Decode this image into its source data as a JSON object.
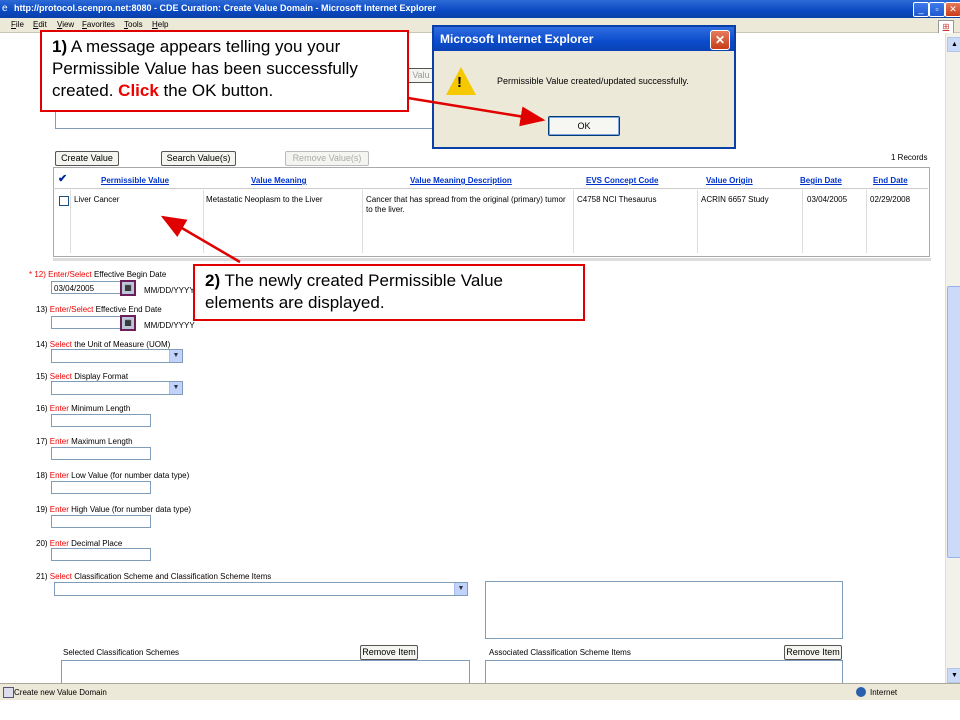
{
  "window": {
    "title": "http://protocol.scenpro.net:8080 - CDE Curation: Create Value Domain - Microsoft Internet Explorer",
    "minimize": "_",
    "maximize": "▫",
    "close": "✕"
  },
  "menu": [
    "File",
    "Edit",
    "View",
    "Favorites",
    "Tools",
    "Help"
  ],
  "toolbar": {
    "create_value": "Create Value",
    "search_values": "Search Value(s)",
    "remove_values": "Remove Value(s)",
    "records": "1 Records",
    "partial_button": "Valu"
  },
  "table": {
    "check_header": "✔",
    "headers": [
      "Permissible Value",
      "Value Meaning",
      "Value Meaning Description",
      "EVS Concept Code",
      "Value Origin",
      "Begin Date",
      "End Date"
    ],
    "row": {
      "permissible_value": "Liver Cancer",
      "value_meaning": "Metastatic Neoplasm to the Liver",
      "description": "Cancer that has spread from the original (primary) tumor to the liver.",
      "evs_code": "C4758 NCI Thesaurus",
      "origin": "ACRIN 6657 Study",
      "begin": "03/04/2005",
      "end": "02/29/2008"
    }
  },
  "fields": {
    "f12": {
      "num": "* 12)",
      "verb": "Enter/Select",
      "label": "Effective Begin Date",
      "value": "03/04/2005",
      "fmt": "MM/DD/YYYY"
    },
    "f13": {
      "num": "13)",
      "verb": "Enter/Select",
      "label": "Effective End Date",
      "fmt": "MM/DD/YYYY"
    },
    "f14": {
      "num": "14)",
      "verb": "Select",
      "label": "the Unit of Measure (UOM)"
    },
    "f15": {
      "num": "15)",
      "verb": "Select",
      "label": "Display Format"
    },
    "f16": {
      "num": "16)",
      "verb": "Enter",
      "label": "Minimum Length"
    },
    "f17": {
      "num": "17)",
      "verb": "Enter",
      "label": "Maximum Length"
    },
    "f18": {
      "num": "18)",
      "verb": "Enter",
      "label": "Low Value (for number data type)"
    },
    "f19": {
      "num": "19)",
      "verb": "Enter",
      "label": "High Value (for number data type)"
    },
    "f20": {
      "num": "20)",
      "verb": "Enter",
      "label": "Decimal Place"
    },
    "f21": {
      "num": "21)",
      "verb": "Select",
      "label": "Classification Scheme and Classification Scheme Items"
    }
  },
  "classification": {
    "selected_label": "Selected Classification Schemes",
    "associated_label": "Associated Classification Scheme Items",
    "remove_item": "Remove Item"
  },
  "dialog": {
    "title": "Microsoft Internet Explorer",
    "message": "Permissible Value created/updated successfully.",
    "ok": "OK"
  },
  "callout1": {
    "num": "1)",
    "text1": "A message appears telling you your Permissible Value has been successfully created.",
    "click": "Click",
    "text2": "the OK button."
  },
  "callout2": {
    "num": "2)",
    "text": "The newly created Permissible Value elements are displayed."
  },
  "status": {
    "left": "Create new Value Domain",
    "right": "Internet"
  },
  "colors": {
    "accent_red": "#e00000",
    "link_blue": "#0033cc",
    "title_blue": "#0a49c2"
  }
}
